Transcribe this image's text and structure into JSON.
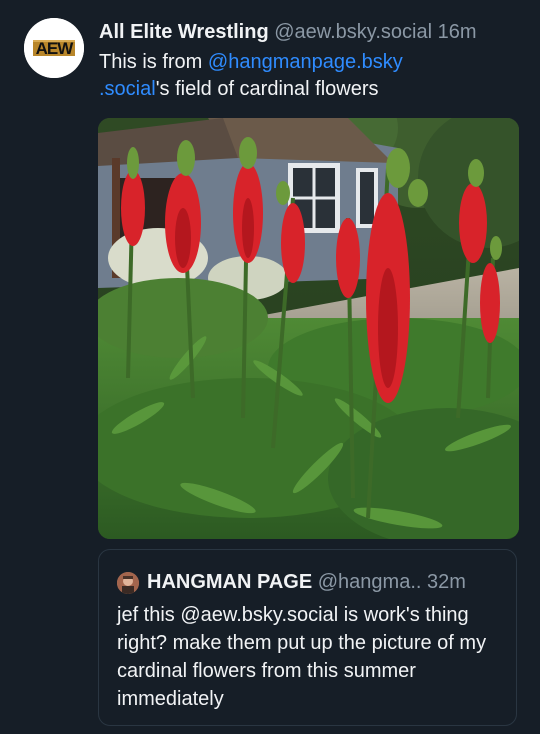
{
  "post": {
    "author": {
      "name": "All Elite Wrestling",
      "handle": "@aew.bsky.social",
      "avatar_text": "AEW"
    },
    "timestamp": "16m",
    "text_part1": "This is from ",
    "mention": "@hangmanpage.bsky\n.social",
    "text_part2": "'s field of cardinal flowers",
    "image": {
      "subject": "cardinal flowers in front of a grey shed"
    }
  },
  "quote": {
    "author": {
      "name": "HANGMAN PAGE",
      "handle": "@hangma.."
    },
    "timestamp": "32m",
    "text": "jef this @aew.bsky.social is work's thing right?  make them put up the picture of my cardinal flowers from this summer immediately"
  },
  "colors": {
    "background": "#161e27",
    "link": "#2f8cff",
    "muted": "#8b98a5",
    "text": "#f1f3f5",
    "flower_red": "#d8232a"
  }
}
